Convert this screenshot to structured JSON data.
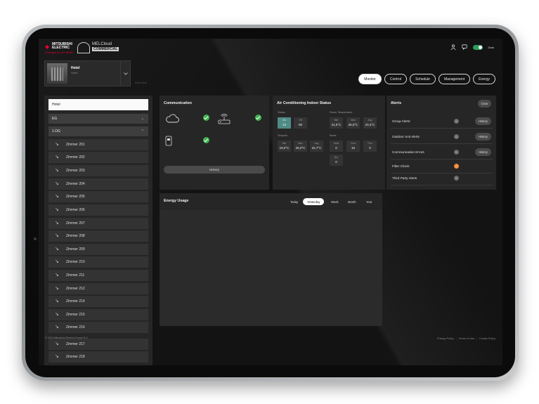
{
  "header": {
    "brand_line1": "MITSUBISHI ELECTRIC",
    "brand_tagline": "Changes for the Better",
    "product_line1": "MELCloud",
    "product_line2": "COMMERCIAL",
    "dark_label": "Dark"
  },
  "site": {
    "name": "Hotel",
    "subtitle": "Hotel",
    "no_site_text": "Kein Item"
  },
  "nav": {
    "items": [
      "Monitor",
      "Control",
      "Schedule",
      "Management",
      "Energy"
    ],
    "active": "Monitor"
  },
  "sidebar": {
    "search_value": "Hotel",
    "groups": [
      {
        "label": "EG"
      },
      {
        "label": "1.OG"
      }
    ],
    "rooms": [
      "Zimmer 201",
      "Zimmer 202",
      "Zimmer 203",
      "Zimmer 204",
      "Zimmer 205",
      "Zimmer 206",
      "Zimmer 207",
      "Zimmer 208",
      "Zimmer 209",
      "Zimmer 210",
      "Zimmer 211",
      "Zimmer 212",
      "Zimmer 214",
      "Zimmer 215",
      "Zimmer 216",
      "Zimmer 217",
      "Zimmer 218"
    ]
  },
  "communication": {
    "title": "Communication",
    "history_label": "History"
  },
  "ac_status": {
    "title": "Air Conditioning Indoor Status",
    "status_label": "Status",
    "on_label": "On",
    "on_value": "15",
    "off_label": "Off",
    "off_value": "00",
    "room_temp_label": "Room Temperature",
    "min_label": "Min",
    "min_value": "21,5°C",
    "max_label": "Max",
    "max_value": "25,0°C",
    "avg_label": "Avg",
    "avg_value": "23,4°C",
    "setpoint_label": "Setpoint",
    "sp_min_value": "19,0°C",
    "sp_max_value": "25,0°C",
    "sp_avg_value": "22,7°C",
    "mode_label": "Mode",
    "heat_label": "Heat",
    "heat_value": "0",
    "cool_label": "Cool",
    "cool_value": "15",
    "fan_label": "Fan",
    "fan_value": "0",
    "dry_label": "Dry",
    "dry_value": "0"
  },
  "alerts": {
    "title": "Alerts",
    "clear_label": "Clear",
    "history_label": "History",
    "rows": [
      {
        "label": "Group Alerts",
        "count": "0"
      },
      {
        "label": "Outdoor Unit Alerts",
        "count": "0"
      },
      {
        "label": "Communication Errors",
        "count": "0"
      },
      {
        "label": "Filter Check",
        "count": "!"
      },
      {
        "label": "Third Party Alerts",
        "count": "0"
      }
    ]
  },
  "energy": {
    "title": "Energy Usage",
    "periods": [
      "Today",
      "Yesterday",
      "Week",
      "Month",
      "Year"
    ],
    "active": "Yesterday"
  },
  "footer": {
    "copyright": "© 2023 Mitsubishi Electric Europe B.V.",
    "links": [
      "Privacy Policy",
      "Terms of Use",
      "Cookie Policy"
    ]
  },
  "colors": {
    "accent_on": "#4f8c86",
    "ok_green": "#3fb34f",
    "warning": "#f08c3a",
    "brand_red": "#e4002b"
  }
}
